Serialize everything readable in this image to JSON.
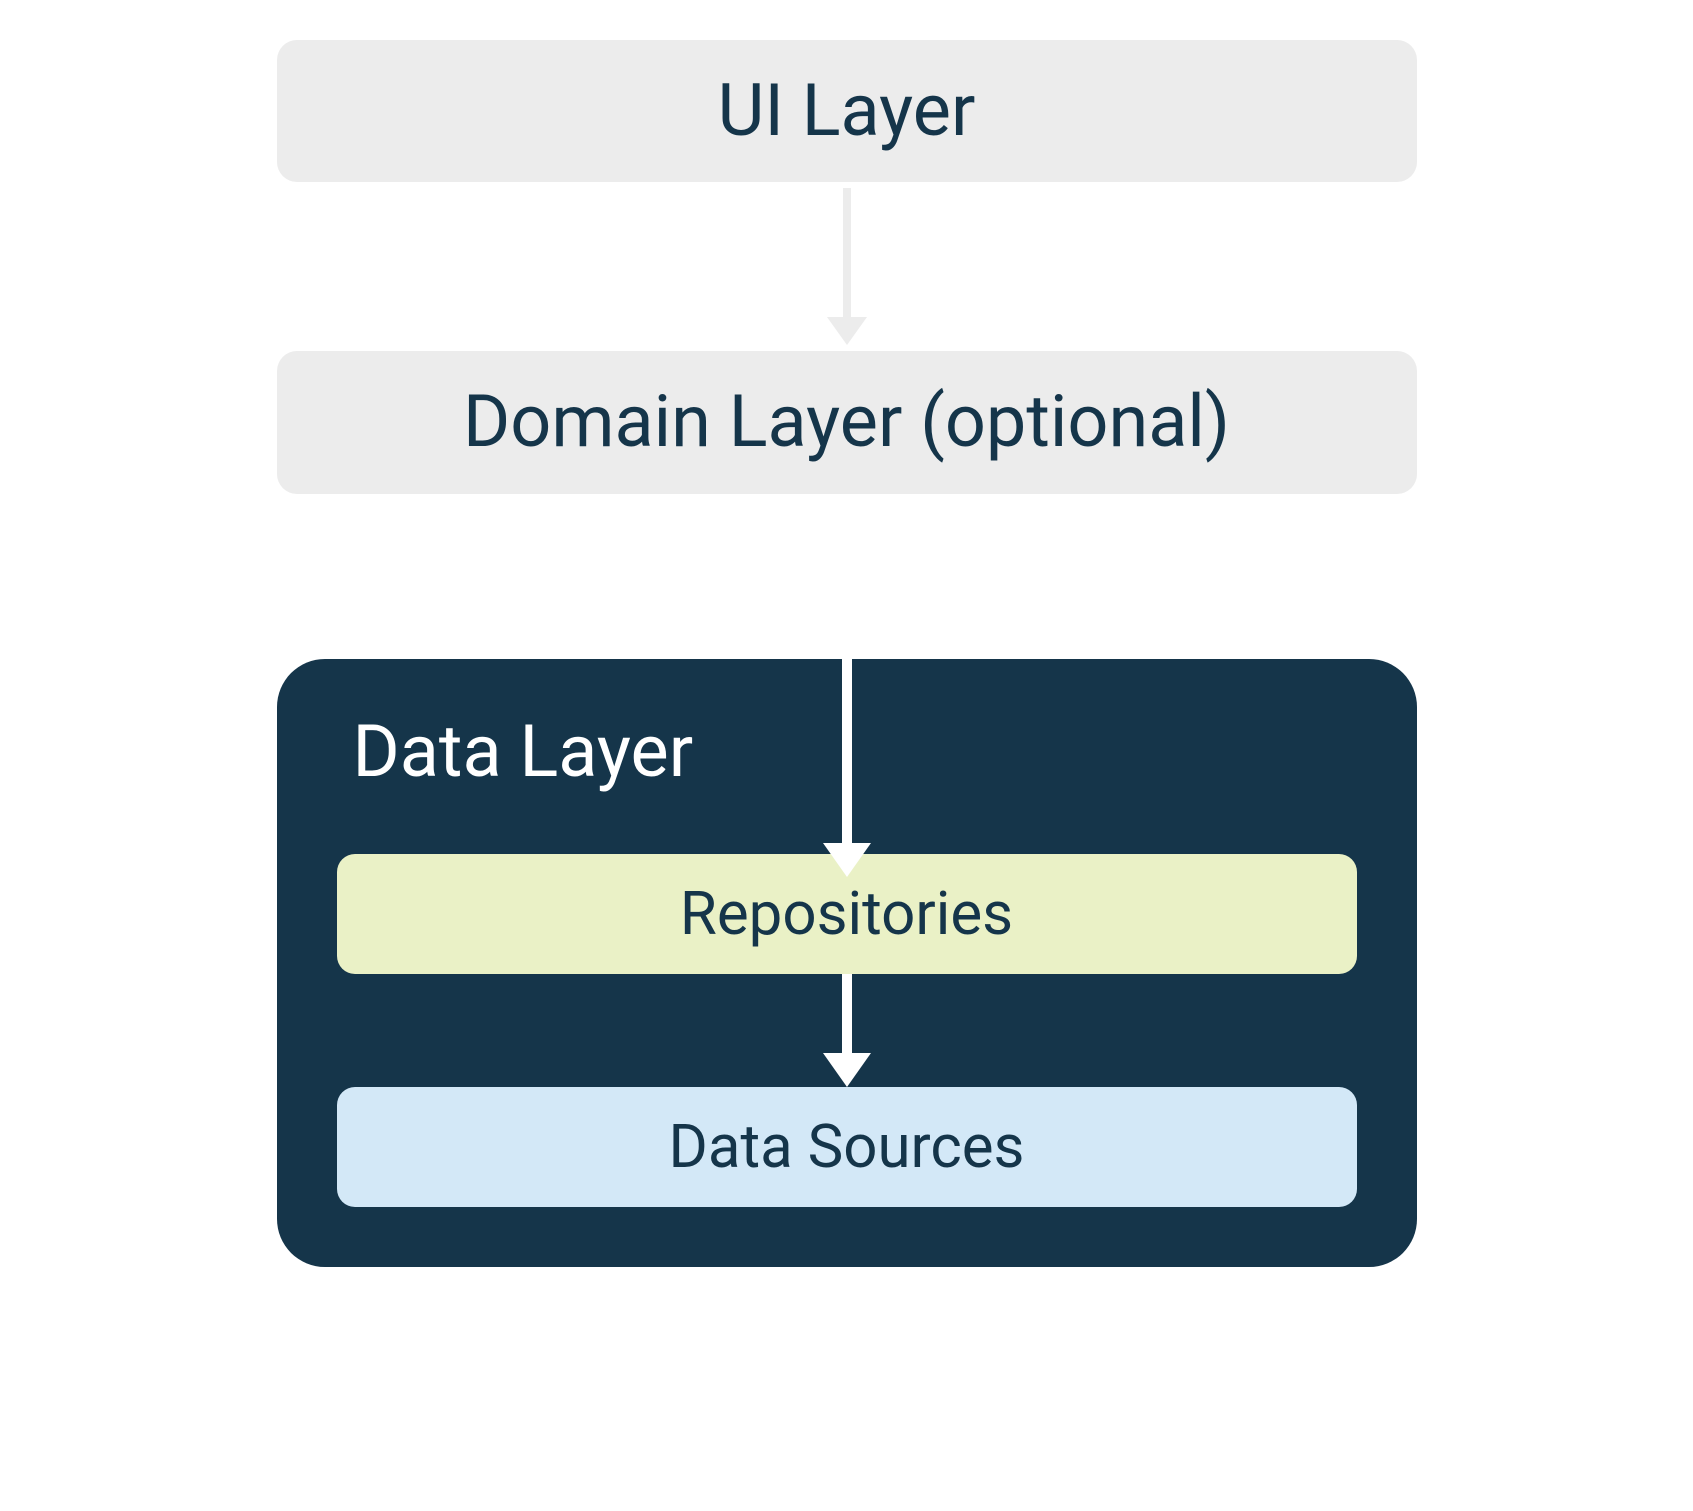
{
  "layers": {
    "ui": "UI Layer",
    "domain": "Domain Layer (optional)",
    "data": {
      "title": "Data Layer",
      "repositories": "Repositories",
      "dataSources": "Data Sources"
    }
  },
  "colors": {
    "lightGray": "#ececec",
    "darkNavy": "#15354a",
    "paleGreen": "#eaf1c6",
    "paleBlue": "#d3e8f7",
    "white": "#ffffff"
  }
}
